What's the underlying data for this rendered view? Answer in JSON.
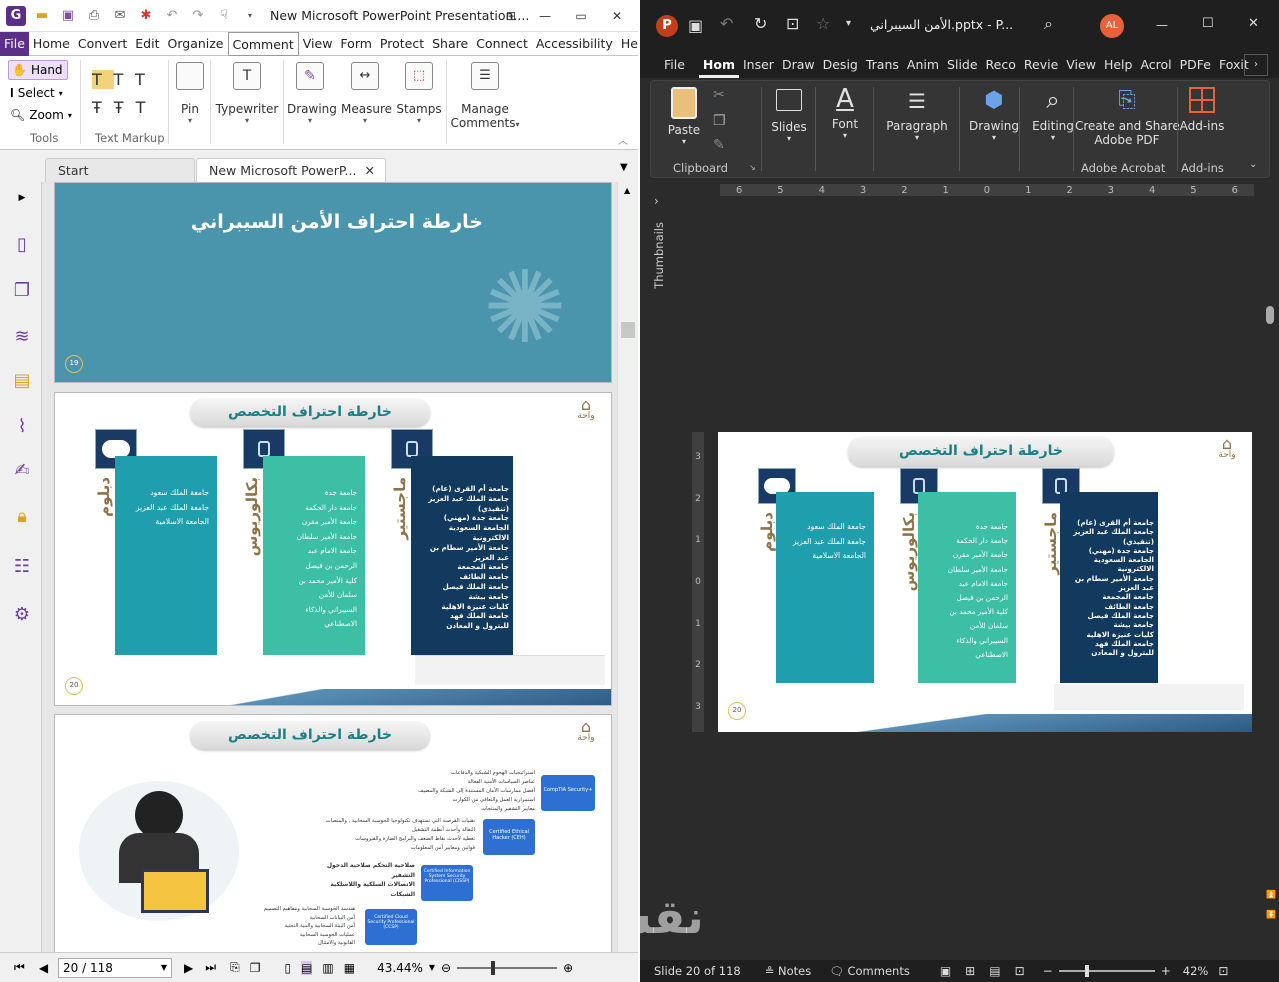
{
  "foxit": {
    "title": "New Microsoft PowerPoint Presentation....",
    "menu": [
      "Home",
      "Convert",
      "Edit",
      "Organize",
      "Comment",
      "View",
      "Form",
      "Protect",
      "Share",
      "Connect",
      "Accessibility",
      "Help"
    ],
    "file_label": "File",
    "active_menu": "Comment",
    "tools": {
      "hand": "Hand",
      "select": "Select",
      "zoom": "Zoom",
      "group": "Tools"
    },
    "text_markup_group": "Text Markup",
    "ribbon_buttons": {
      "pin": "Pin",
      "typewriter": "Typewriter",
      "drawing": "Drawing",
      "measure": "Measure",
      "stamps": "Stamps",
      "manage": "Manage",
      "comments": "Comments"
    },
    "tabs": {
      "start": "Start",
      "doc": "New Microsoft PowerP..."
    },
    "slides": {
      "s19": {
        "title": "خارطة احتراف الأمن السيبراني",
        "num": "19"
      },
      "s20": {
        "title": "خارطة احتراف التخصص",
        "num": "20",
        "logo": "واحة",
        "diploma": {
          "label": "دبلوم",
          "items": [
            "جامعة الملك سعود",
            "جامعة الملك عبد العزيز",
            "الجامعة الاسلامية"
          ]
        },
        "bachelor": {
          "label": "بكالوريوس",
          "items": [
            "جامعة جدة",
            "جامعة دار الحكمة",
            "جامعة الأمير مقرن",
            "جامعة الأمير سلطان",
            "جامعة الامام عبد",
            "الرحمن بن فيصل",
            "كلية الأمير محمد بن",
            "سلمان للأمن",
            "السيبراني والذكاء",
            "الاصطناعي"
          ]
        },
        "master": {
          "label": "ماجستير",
          "items": [
            "جامعة أم القرى (عام)",
            "جامعة الملك عبد العزيز",
            "(تنفيذي)",
            "جامعة جدة (مهني)",
            "الجامعة السعودية",
            "الالكترونية",
            "جامعة الأمير سطام بن",
            "عبد العزيز",
            "جامعة المجمعة",
            "جامعة الطائف",
            "جامعة الملك فيصل",
            "جامعة بيشة",
            "كليات عنيزة الاهلية",
            "جامعة الملك فهد",
            "للبترول و المعادن"
          ]
        }
      },
      "s21": {
        "title": "خارطة احتراف التخصص",
        "logo": "واحة",
        "certs": [
          "CompTIA Security+",
          "Certified Ethical Hacker (CEH)",
          "Certified Information System Security Professional (CISSP)",
          "Certified Cloud Security Professional (CCSP)"
        ],
        "text1": [
          "استراتيجيات الهجوم الشبكية والدفاعات",
          "عناصر السياسات الأمنية الفعالة",
          "أفضل ممارسات الأمان المستندة إلى الشبكة والمضيف",
          "استمرارية العمل والتعافي من الكوارث",
          "معايير التشفير والمنتجات"
        ],
        "text2": [
          "تقنيات القرصنة التي تستهدف تكنولوجيا الحوسبة السحابية , والمنصات",
          "النقالة وأحدث أنظمة التشغيل",
          "تغطية لأحدث نقاط الضعف والبرامج الضارة والفيروسات",
          "قوانين ومعايير أمن المعلومات"
        ],
        "text3": [
          "صلاحية التحكم صلاحية الدخول",
          "التشفير",
          "الاتصالات السلكية واللاسلكية",
          "الشبكات"
        ],
        "text4": [
          "هندسة الحوسبة السحابية ومفاهيم التصميم",
          "أمن البيانات السحابية",
          "أمن البيئة السحابية والبنية التحتية",
          "عمليات الحوسبة السحابية",
          "القانونية والامتثال"
        ]
      }
    },
    "status": {
      "page": "20 / 118",
      "zoom": "43.44%"
    }
  },
  "ppt": {
    "title": "الأمن السيبراني.pptx  -  P...",
    "avatar": "AL",
    "menu": [
      "File",
      "Hom",
      "Inser",
      "Draw",
      "Desig",
      "Trans",
      "Anim",
      "Slide",
      "Reco",
      "Revie",
      "View",
      "Help",
      "Acrol",
      "PDFe",
      "Foxit"
    ],
    "active_menu": "Hom",
    "ribbon": {
      "paste": "Paste",
      "clipboard": "Clipboard",
      "slides": "Slides",
      "font": "Font",
      "paragraph": "Paragraph",
      "drawing": "Drawing",
      "editing": "Editing",
      "create1": "Create and Share",
      "create2": "Adobe PDF",
      "adobe": "Adobe Acrobat",
      "addins": "Add-ins",
      "addins_group": "Add-ins"
    },
    "thumbnails": "Thumbnails",
    "ruler": [
      "6",
      "5",
      "4",
      "3",
      "2",
      "1",
      "0",
      "1",
      "2",
      "3",
      "4",
      "5",
      "6"
    ],
    "vruler": [
      "3",
      "2",
      "1",
      "0",
      "1",
      "2",
      "3"
    ],
    "status": {
      "slide": "Slide 20 of 118",
      "notes": "Notes",
      "comments": "Comments",
      "zoom": "42%"
    }
  },
  "watermark": "نقشي"
}
